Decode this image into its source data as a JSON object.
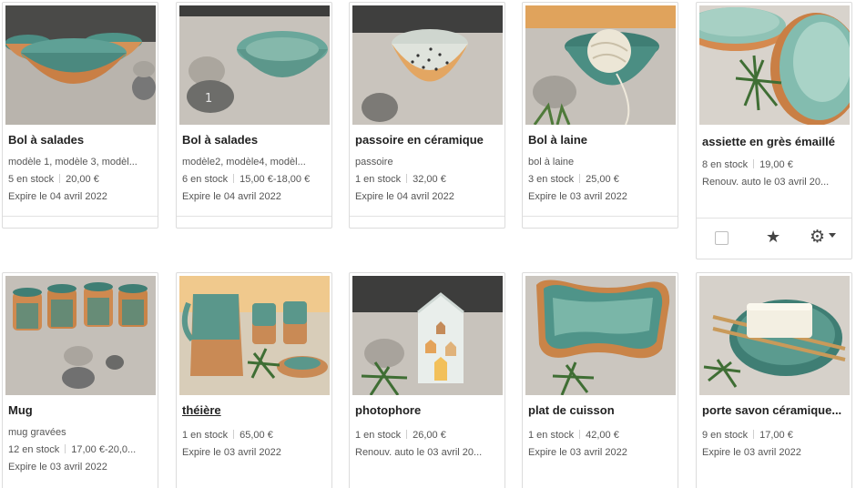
{
  "listings": [
    {
      "title": "Bol à salades",
      "subtitle": "modèle 1, modèle 3, modèl...",
      "stock": "5 en stock",
      "price": "20,00 €",
      "expiry": "Expire le 04 avril 2022",
      "image": "green-salad-bowls"
    },
    {
      "title": "Bol à salades",
      "subtitle": "modèle2, modèle4, modèl...",
      "stock": "6 en stock",
      "price": "15,00 €-18,00 €",
      "expiry": "Expire le 04 avril 2022",
      "image": "green-bowl-with-pebbles"
    },
    {
      "title": "passoire en céramique",
      "subtitle": "passoire",
      "stock": "1 en stock",
      "price": "32,00 €",
      "expiry": "Expire le 04 avril 2022",
      "image": "ceramic-colander"
    },
    {
      "title": "Bol à laine",
      "subtitle": "bol à laine",
      "stock": "3 en stock",
      "price": "25,00 €",
      "expiry": "Expire le 03 avril 2022",
      "image": "yarn-bowl"
    },
    {
      "title": "assiette en grès émaillé",
      "subtitle": "",
      "stock": "8 en stock",
      "price": "19,00 €",
      "expiry": "Renouv. auto le 03 avril 20...",
      "image": "stoneware-plates"
    },
    {
      "title": "Mug",
      "subtitle": "mug gravées",
      "stock": "12 en stock",
      "price": "17,00 €-20,0...",
      "expiry": "Expire le 03 avril 2022",
      "image": "green-mugs"
    },
    {
      "title": "théière",
      "subtitle": "",
      "stock": "1 en stock",
      "price": "65,00 €",
      "expiry": "Expire le 03 avril 2022",
      "image": "teapot-set"
    },
    {
      "title": "photophore",
      "subtitle": "",
      "stock": "1 en stock",
      "price": "26,00 €",
      "expiry": "Renouv. auto le 03 avril 20...",
      "image": "house-candle-holder"
    },
    {
      "title": "plat de cuisson",
      "subtitle": "",
      "stock": "1 en stock",
      "price": "42,00 €",
      "expiry": "Expire le 03 avril 2022",
      "image": "baking-dish"
    },
    {
      "title": "porte savon céramique...",
      "subtitle": "",
      "stock": "9 en stock",
      "price": "17,00 €",
      "expiry": "Expire le 03 avril 2022",
      "image": "soap-dish"
    }
  ],
  "icons": {
    "star": "star-icon",
    "gear": "gear-icon",
    "caret": "caret-down-icon"
  },
  "colors": {
    "glaze": "#5e9c8f",
    "clay": "#d9955a",
    "stone": "#8c8c8c",
    "text": "#222222",
    "muted": "#555555"
  }
}
